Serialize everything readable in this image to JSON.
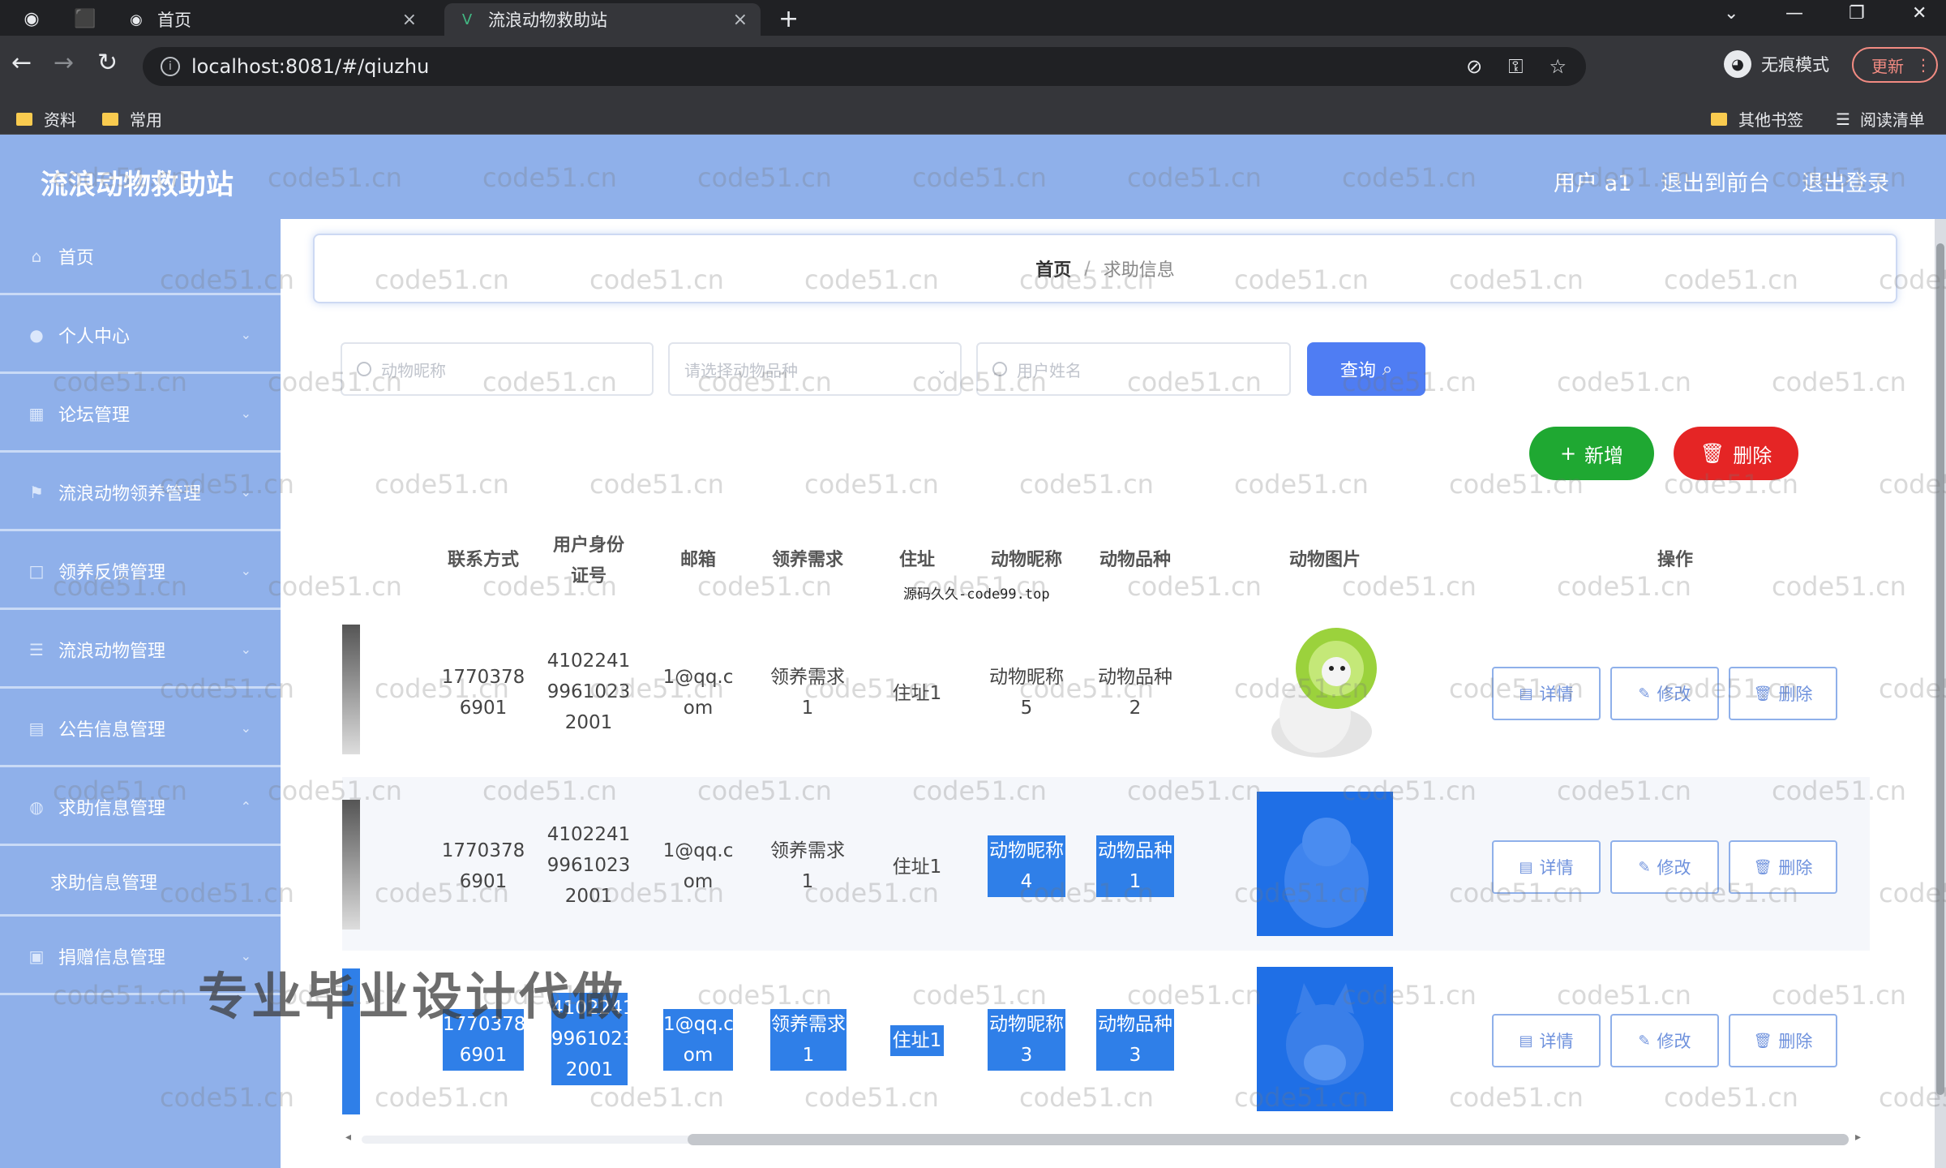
{
  "browser": {
    "tabs": [
      {
        "label": "首页",
        "active": false
      },
      {
        "label": "流浪动物救助站",
        "active": true
      }
    ],
    "url": "localhost:8081/#/qiuzhu",
    "incognito_label": "无痕模式",
    "update_label": "更新",
    "bookmarks": [
      "资料",
      "常用"
    ],
    "other_bookmarks": "其他书签",
    "reading_list": "阅读清单"
  },
  "header": {
    "title": "流浪动物救助站",
    "user": "用户 a1",
    "back_to_front": "退出到前台",
    "logout": "退出登录"
  },
  "sidebar": {
    "items": [
      {
        "label": "首页",
        "icon": "home-icon"
      },
      {
        "label": "个人中心",
        "icon": "user-icon"
      },
      {
        "label": "论坛管理",
        "icon": "forum-icon"
      },
      {
        "label": "流浪动物领养管理",
        "icon": "flag-icon"
      },
      {
        "label": "领养反馈管理",
        "icon": "feedback-icon"
      },
      {
        "label": "流浪动物管理",
        "icon": "list-icon"
      },
      {
        "label": "公告信息管理",
        "icon": "notice-icon"
      },
      {
        "label": "求助信息管理",
        "icon": "help-icon"
      },
      {
        "label": "求助信息管理",
        "icon": ""
      },
      {
        "label": "捐赠信息管理",
        "icon": "donate-icon"
      }
    ]
  },
  "breadcrumb": {
    "home": "首页",
    "current": "求助信息"
  },
  "search": {
    "animal_name_placeholder": "动物昵称",
    "breed_placeholder": "请选择动物品种",
    "user_name_placeholder": "用户姓名",
    "query_label": "查询"
  },
  "actions": {
    "add_label": "新增",
    "delete_label": "删除"
  },
  "table": {
    "headers": [
      "联系方式",
      "用户身份\n证号",
      "邮箱",
      "领养需求",
      "住址",
      "动物昵称",
      "动物品种",
      "动物图片",
      "操作"
    ],
    "rows": [
      {
        "phone": "1770378\n6901",
        "id_card": "4102241\n9961023\n2001",
        "email": "1@qq.c\nom",
        "demand": "领养需求\n1",
        "address": "住址1",
        "nickname": "动物昵称\n5",
        "breed": "动物品种\n2"
      },
      {
        "phone": "1770378\n6901",
        "id_card": "4102241\n9961023\n2001",
        "email": "1@qq.c\nom",
        "demand": "领养需求\n1",
        "address": "住址1",
        "nickname": "动物昵称\n4",
        "breed": "动物品种\n1"
      },
      {
        "phone": "1770378\n6901",
        "id_card": "4102241\n9961023\n2001",
        "email": "1@qq.c\nom",
        "demand": "领养需求\n1",
        "address": "住址1",
        "nickname": "动物昵称\n3",
        "breed": "动物品种\n3"
      }
    ],
    "op_detail": "详情",
    "op_edit": "修改",
    "op_delete": "删除"
  },
  "overlay": {
    "big_text": "专业毕业设计代做",
    "small_text": "源码久久-code99.top"
  },
  "watermark": "code51.cn",
  "colors": {
    "primary": "#8fb0ea",
    "query": "#4f7df3",
    "add": "#1fa832",
    "delete": "#e52525"
  }
}
